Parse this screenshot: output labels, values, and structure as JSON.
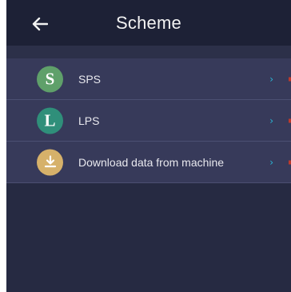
{
  "header": {
    "title": "Scheme",
    "back_icon": "arrow-left-icon"
  },
  "list": {
    "items": [
      {
        "letter": "S",
        "label": "SPS",
        "icon_color": "#5fa06a",
        "chevron": "›"
      },
      {
        "letter": "L",
        "label": "LPS",
        "icon_color": "#2f8f7a",
        "chevron": "›"
      },
      {
        "icon": "download-icon",
        "label": "Download data from machine",
        "icon_color": "#d6b16a",
        "chevron": "›"
      }
    ]
  },
  "colors": {
    "background": "#262a42",
    "header": "#1d2136",
    "row": "#373a5a",
    "accent": "#29b6d6"
  }
}
